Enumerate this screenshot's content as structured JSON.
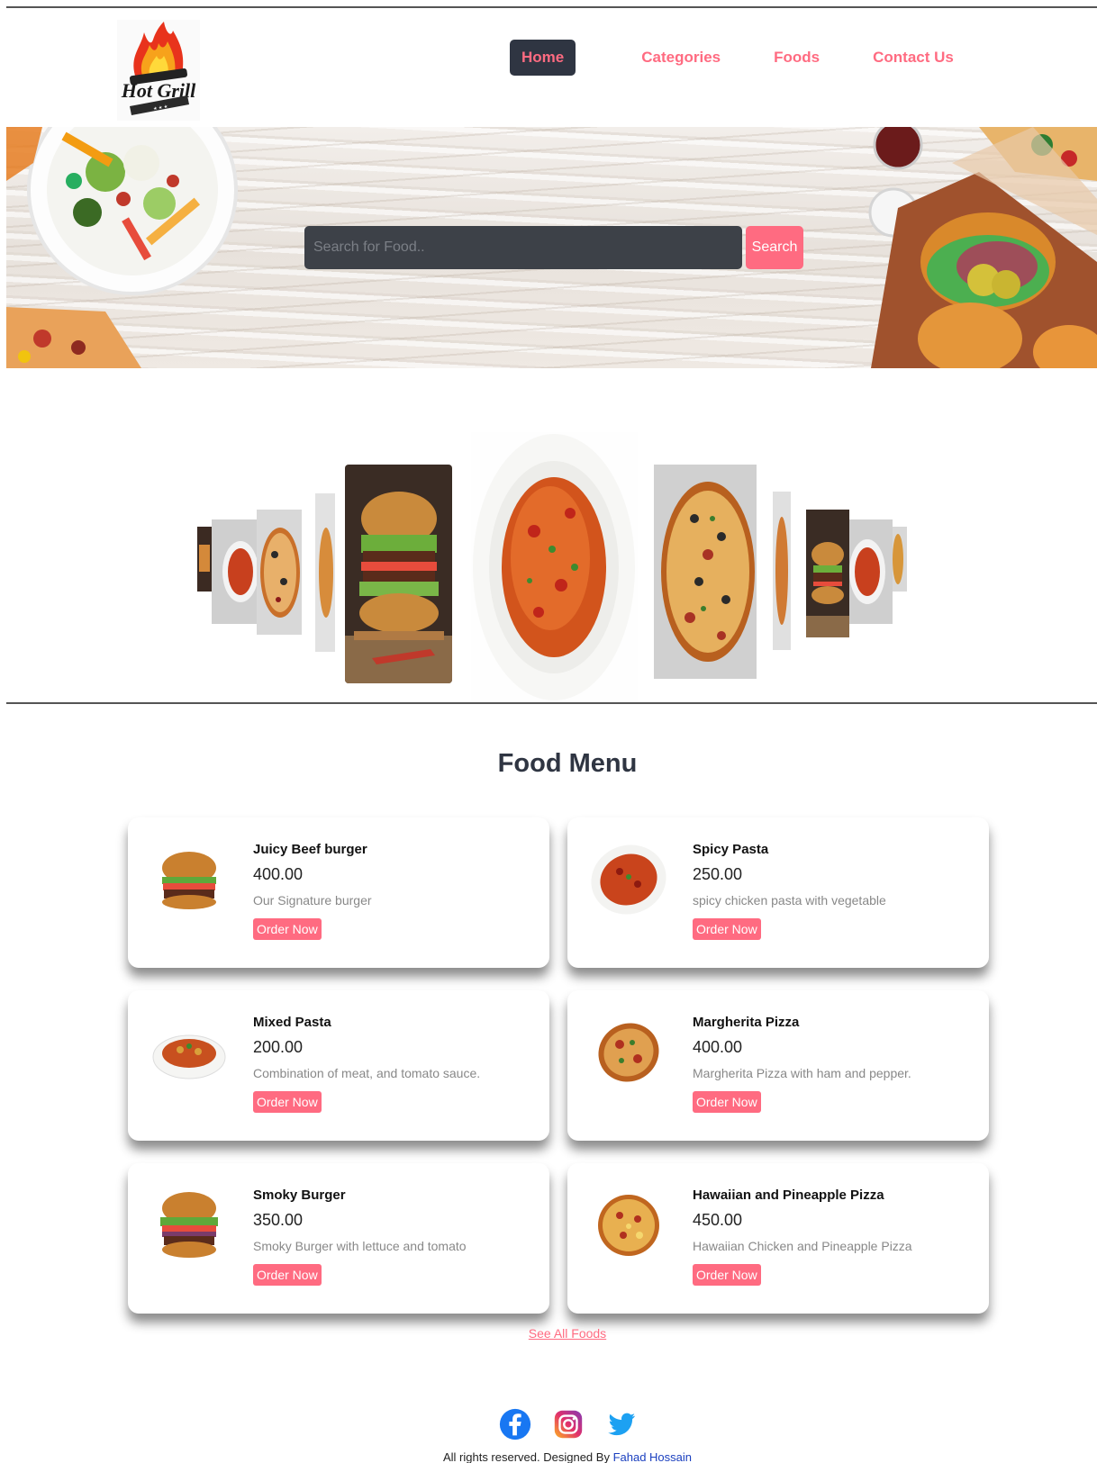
{
  "nav": {
    "items": [
      {
        "label": "Home",
        "active": true
      },
      {
        "label": "Categories",
        "active": false
      },
      {
        "label": "Foods",
        "active": false
      },
      {
        "label": "Contact Us",
        "active": false
      }
    ]
  },
  "logo": {
    "text": "Hot Grill"
  },
  "search": {
    "placeholder": "Search for Food..",
    "button_label": "Search"
  },
  "menu": {
    "title": "Food Menu",
    "items": [
      {
        "name": "Juicy Beef burger",
        "price": "400.00",
        "description": "Our Signature burger",
        "order_label": "Order Now",
        "icon": "burger-image"
      },
      {
        "name": "Spicy Pasta",
        "price": "250.00",
        "description": "spicy chicken pasta with vegetable",
        "order_label": "Order Now",
        "icon": "pasta-image"
      },
      {
        "name": "Mixed Pasta",
        "price": "200.00",
        "description": "Combination of meat, and tomato sauce.",
        "order_label": "Order Now",
        "icon": "pasta-plate-image"
      },
      {
        "name": "Margherita Pizza",
        "price": "400.00",
        "description": "Margherita Pizza with ham and pepper.",
        "order_label": "Order Now",
        "icon": "pizza-image"
      },
      {
        "name": "Smoky Burger",
        "price": "350.00",
        "description": "Smoky Burger with lettuce and tomato",
        "order_label": "Order Now",
        "icon": "burger-image"
      },
      {
        "name": "Hawaiian and Pineapple Pizza",
        "price": "450.00",
        "description": "Hawaiian Chicken and Pineapple Pizza",
        "order_label": "Order Now",
        "icon": "pizza-image"
      }
    ],
    "see_all_label": "See All Foods"
  },
  "footer": {
    "social": [
      "facebook-icon",
      "instagram-icon",
      "twitter-icon"
    ],
    "copyright_text": "All rights reserved. Designed By ",
    "author": "Fahad Hossain"
  },
  "colors": {
    "accent": "#ff6b81",
    "dark": "#2f3542",
    "facebook": "#1877f2",
    "twitter": "#1da1f2"
  }
}
